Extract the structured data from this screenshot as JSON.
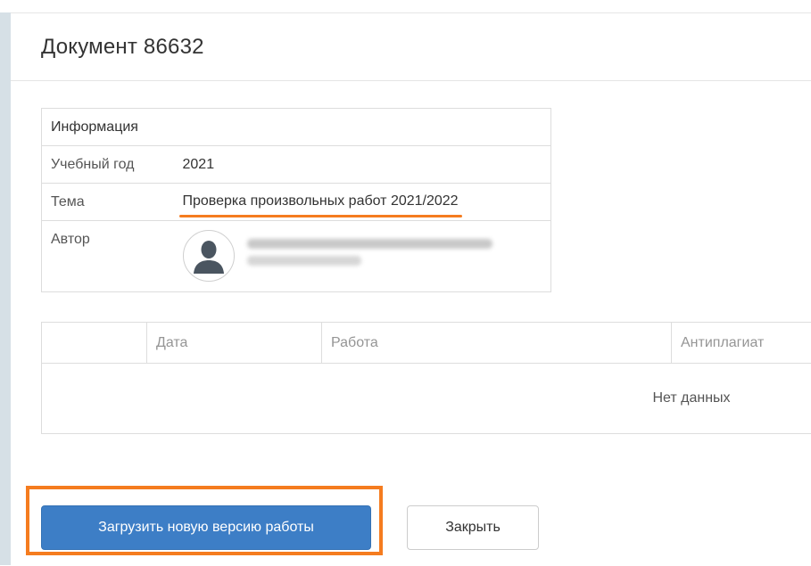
{
  "modal": {
    "title": "Документ 86632"
  },
  "info": {
    "header": "Информация",
    "rows": [
      {
        "key": "Учебный год",
        "value": "2021"
      },
      {
        "key": "Тема",
        "value": "Проверка произвольных работ 2021/2022"
      },
      {
        "key": "Автор",
        "value": ""
      }
    ]
  },
  "grid": {
    "columns": [
      "",
      "Дата",
      "Работа",
      "Антиплагиат"
    ],
    "empty_text": "Нет данных"
  },
  "footer": {
    "upload_label": "Загрузить новую версию работы",
    "close_label": "Закрыть"
  },
  "colors": {
    "primary": "#3d7ec6",
    "highlight": "#f57c1f",
    "border": "#dddddd"
  },
  "icons": {
    "avatar": "user-silhouette-icon"
  }
}
